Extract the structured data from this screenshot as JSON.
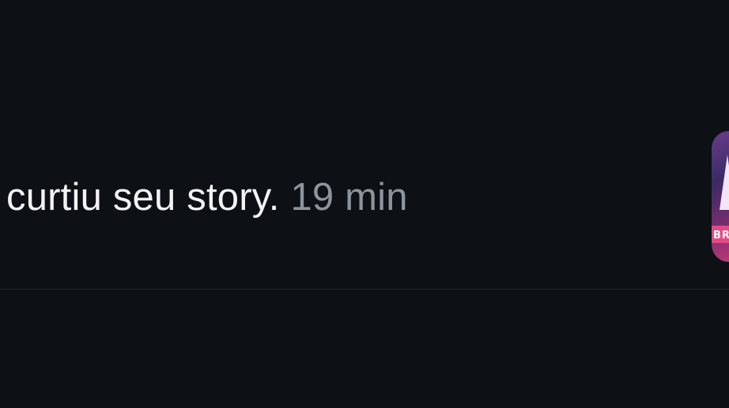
{
  "notification": {
    "action": "curtiu seu story.",
    "time": "19 min",
    "thumbnail_logo": "BR"
  },
  "colors": {
    "background": "#0d1015",
    "primary_text": "#f2f3f5",
    "secondary_text": "#8e949c",
    "divider": "#24272d"
  }
}
